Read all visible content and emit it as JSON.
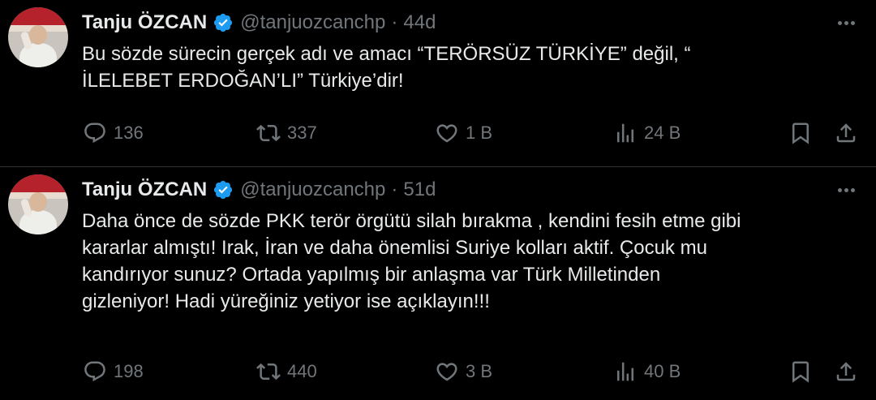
{
  "tweets": [
    {
      "author_name": "Tanju ÖZCAN",
      "handle": "@tanjuozcanchp",
      "separator": "·",
      "time": "44d",
      "text": "Bu sözde sürecin gerçek adı ve amacı “TERÖRSÜZ TÜRKİYE” değil, “\nİLELEBET ERDOĞAN’LI” Türkiye’dir!",
      "replies": "136",
      "retweets": "337",
      "likes": "1 B",
      "views": "24 B"
    },
    {
      "author_name": "Tanju ÖZCAN",
      "handle": "@tanjuozcanchp",
      "separator": "·",
      "time": "51d",
      "text": "Daha önce de sözde PKK terör örgütü silah bırakma , kendini fesih etme gibi\nkararlar almıştı! Irak, İran ve daha önemlisi Suriye kolları aktif. Çocuk mu\nkandırıyor sunuz? Ortada yapılmış bir anlaşma var Türk Milletinden\ngizleniyor! Hadi yüreğiniz yetiyor ise açıklayın!!!",
      "replies": "198",
      "retweets": "440",
      "likes": "3 B",
      "views": "40 B"
    }
  ],
  "icons": {
    "verified": "verified-badge-icon",
    "more": "more-icon",
    "reply": "reply-icon",
    "retweet": "retweet-icon",
    "like": "heart-icon",
    "views": "views-icon",
    "bookmark": "bookmark-icon",
    "share": "share-icon"
  },
  "colors": {
    "background": "#000000",
    "text": "#e7e9ea",
    "muted": "#71767b",
    "verified": "#1d9bf0",
    "divider": "#2f3336"
  }
}
